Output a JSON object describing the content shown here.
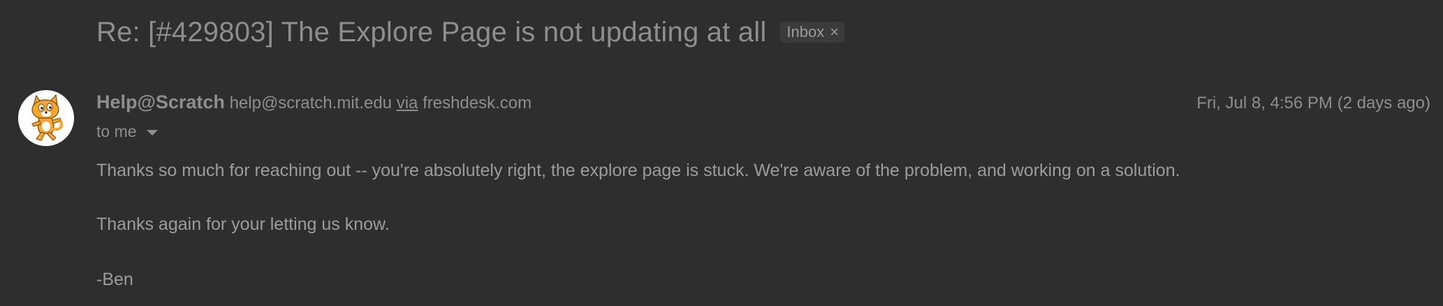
{
  "subject": "Re: [#429803] The Explore Page is not updating at all",
  "label_chip": {
    "text": "Inbox",
    "close_glyph": "×"
  },
  "sender": {
    "name": "Help@Scratch",
    "email": "help@scratch.mit.edu",
    "via_text": "via",
    "via_domain": "freshdesk.com",
    "avatar_icon": "scratch-cat-avatar"
  },
  "date": "Fri, Jul 8, 4:56 PM (2 days ago)",
  "recipient": "to me",
  "body": {
    "paragraph1": "Thanks so much for reaching out -- you're absolutely right, the explore page is stuck. We're aware of the problem, and working on a solution.",
    "paragraph2": "Thanks again for your letting us know.",
    "signature": "-Ben"
  },
  "colors": {
    "background": "#2d2e2d",
    "text": "#8e8e8e",
    "chip_bg": "#3a3b3a",
    "avatar_orange": "#f7a52c"
  }
}
